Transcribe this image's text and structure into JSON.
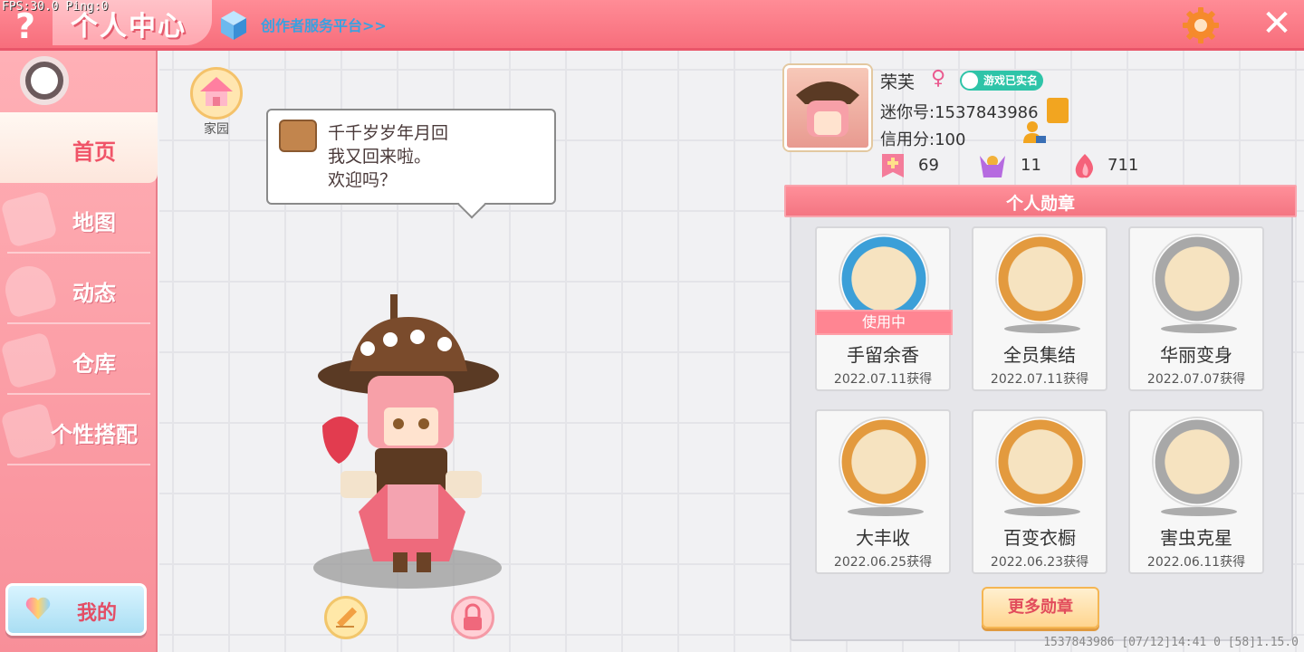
{
  "debug": {
    "fps": "FPS:30.0  Ping:0"
  },
  "header": {
    "help": "?",
    "title": "个人中心",
    "creator_link": "创作者服务平台>>",
    "close": "✕"
  },
  "sidebar": {
    "items": [
      {
        "label": "首页"
      },
      {
        "label": "地图"
      },
      {
        "label": "动态"
      },
      {
        "label": "仓库"
      },
      {
        "label": "个性搭配"
      }
    ],
    "mine_label": "我的"
  },
  "main": {
    "home_label": "家园",
    "bubble_lines": [
      "千千岁岁年月回",
      "我又回来啦。",
      "欢迎吗？"
    ]
  },
  "profile": {
    "name": "荣芙",
    "gender": "♀",
    "verified": "游戏已实名",
    "mini_id": "迷你号:1537843986",
    "credit": "信用分:100",
    "stats": [
      {
        "icon": "plus-flag-icon",
        "value": "69"
      },
      {
        "icon": "cheer-icon",
        "value": "11"
      },
      {
        "icon": "flame-icon",
        "value": "711"
      }
    ]
  },
  "medals": {
    "header": "个人勋章",
    "in_use_label": "使用中",
    "items": [
      {
        "name": "手留余香",
        "date": "2022.07.11获得",
        "rim": "#3b9fd8"
      },
      {
        "name": "全员集结",
        "date": "2022.07.11获得",
        "rim": "#e39a3e"
      },
      {
        "name": "华丽变身",
        "date": "2022.07.07获得",
        "rim": "#a8a8a8"
      },
      {
        "name": "大丰收",
        "date": "2022.06.25获得",
        "rim": "#e39a3e"
      },
      {
        "name": "百变衣橱",
        "date": "2022.06.23获得",
        "rim": "#e39a3e"
      },
      {
        "name": "害虫克星",
        "date": "2022.06.11获得",
        "rim": "#a8a8a8"
      }
    ],
    "more_button": "更多勋章"
  },
  "footer": "1537843986   [07/12]14:41 0  [58]1.15.0"
}
